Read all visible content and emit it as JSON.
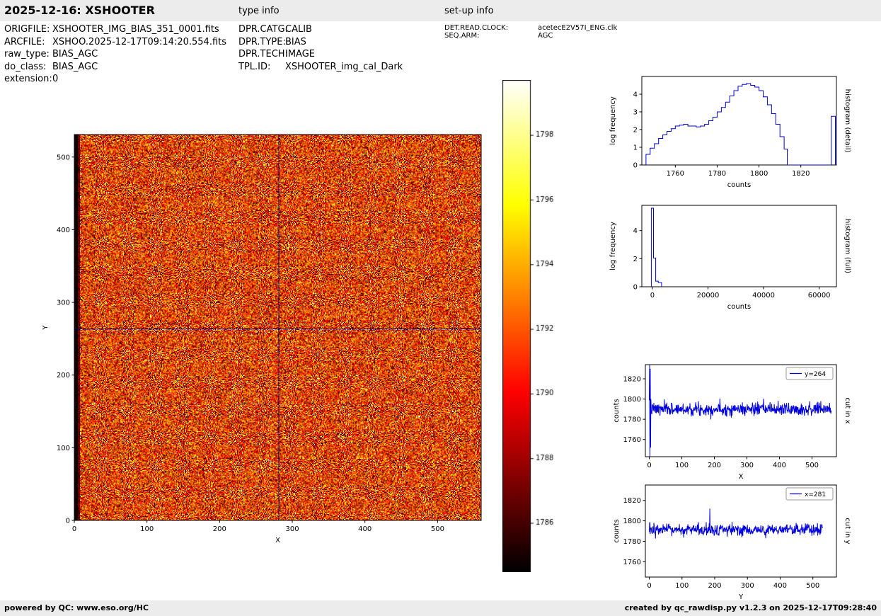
{
  "header": {
    "title": "2025-12-16: XSHOOTER",
    "type_info_label": "type info",
    "setup_info_label": "set-up info"
  },
  "meta": {
    "left": [
      {
        "label": "ORIGFILE:",
        "value": "XSHOOTER_IMG_BIAS_351_0001.fits"
      },
      {
        "label": "ARCFILE:",
        "value": "XSHOO.2025-12-17T09:14:20.554.fits"
      },
      {
        "label": "raw_type:",
        "value": "BIAS_AGC"
      },
      {
        "label": "do_class:",
        "value": "BIAS_AGC"
      },
      {
        "label": "extension:",
        "value": "0"
      }
    ],
    "type": [
      {
        "label": "DPR.CATG:",
        "value": "CALIB"
      },
      {
        "label": "DPR.TYPE:",
        "value": "BIAS"
      },
      {
        "label": "DPR.TECH:",
        "value": "IMAGE"
      },
      {
        "label": "TPL.ID:",
        "value": "XSHOOTER_img_cal_Dark"
      }
    ],
    "setup": [
      {
        "label": "DET.READ.CLOCK:",
        "value": "acetecE2V57I_ENG.clk"
      },
      {
        "label": "SEQ.ARM:",
        "value": "AGC"
      }
    ]
  },
  "footer": {
    "left": "powered by QC: www.eso.org/HC",
    "right": "created by qc_rawdisp.py v1.2.3 on 2025-12-17T09:28:40"
  },
  "chart_data": [
    {
      "id": "bias_image",
      "type": "heatmap",
      "xlabel": "X",
      "ylabel": "Y",
      "xlim": [
        0,
        560
      ],
      "ylim": [
        0,
        531
      ],
      "xticks": [
        0,
        100,
        200,
        300,
        400,
        500
      ],
      "yticks": [
        0,
        100,
        200,
        300,
        400,
        500
      ],
      "colormap": "hot",
      "counts_range": [
        1784.5,
        1799.7
      ],
      "mean_counts": 1791,
      "noise_sigma_counts": 3.4,
      "dark_left_columns": 8,
      "crosshair": {
        "x": 281,
        "y": 264,
        "color": "#00008b"
      },
      "seed": 42
    },
    {
      "id": "colorbar",
      "type": "colorbar",
      "colormap": "hot",
      "range": [
        1784.5,
        1799.7
      ],
      "ticks": [
        1786,
        1788,
        1790,
        1792,
        1794,
        1796,
        1798
      ]
    },
    {
      "id": "histogram_detail",
      "type": "steps",
      "right_label": "histogram (detail)",
      "xlabel": "counts",
      "ylabel": "log frequency",
      "xlim": [
        1744,
        1837
      ],
      "ylim": [
        0,
        5
      ],
      "xticks": [
        1760,
        1780,
        1800,
        1820
      ],
      "yticks": [
        0,
        1,
        2,
        3,
        4
      ],
      "line_color": "#0000dd",
      "x": [
        1746,
        1748,
        1750,
        1752,
        1754,
        1756,
        1758,
        1760,
        1762,
        1764,
        1766,
        1768,
        1770,
        1772,
        1774,
        1776,
        1778,
        1780,
        1782,
        1784,
        1786,
        1788,
        1790,
        1792,
        1794,
        1796,
        1798,
        1800,
        1802,
        1804,
        1806,
        1808,
        1810,
        1812,
        1813.5,
        1834.5,
        1836.5
      ],
      "y": [
        0.6,
        0.95,
        1.2,
        1.5,
        1.7,
        1.9,
        2.05,
        2.2,
        2.25,
        2.3,
        2.2,
        2.2,
        2.15,
        2.2,
        2.3,
        2.5,
        2.7,
        3.0,
        3.25,
        3.55,
        3.9,
        4.2,
        4.45,
        4.55,
        4.6,
        4.5,
        4.4,
        4.2,
        3.85,
        3.4,
        2.9,
        2.3,
        1.6,
        0.9,
        0,
        2.75,
        0
      ]
    },
    {
      "id": "histogram_full",
      "type": "steps",
      "right_label": "histogram (full)",
      "xlabel": "counts",
      "ylabel": "log frequency",
      "xlim": [
        -3800,
        66200
      ],
      "ylim": [
        0,
        5.8
      ],
      "xticks": [
        0,
        20000,
        40000,
        60000
      ],
      "yticks": [
        0,
        2,
        4
      ],
      "line_color": "#0000dd",
      "x": [
        -400,
        400,
        1200,
        2100,
        3300
      ],
      "y": [
        5.6,
        2.05,
        0.4,
        0.3,
        0
      ]
    },
    {
      "id": "cut_x",
      "type": "noise_line",
      "legend": "y=264",
      "right_label": "cut in x",
      "xlabel": "X",
      "ylabel": "counts",
      "xlim": [
        -12,
        575
      ],
      "ylim": [
        1743,
        1834
      ],
      "xticks": [
        0,
        100,
        200,
        300,
        400,
        500
      ],
      "yticks": [
        1760,
        1780,
        1800,
        1820
      ],
      "line_color": "#0000dd",
      "n": 560,
      "baseline": 1790,
      "sigma": 3.2,
      "seed": 7,
      "spikes": [
        [
          1,
          1834
        ],
        [
          2,
          1743
        ],
        [
          3,
          1830
        ],
        [
          4,
          1752
        ],
        [
          5,
          1800
        ]
      ]
    },
    {
      "id": "cut_y",
      "type": "noise_line",
      "legend": "x=281",
      "right_label": "cut in y",
      "xlabel": "Y",
      "ylabel": "counts",
      "xlim": [
        -12,
        572
      ],
      "ylim": [
        1745,
        1835
      ],
      "xticks": [
        0,
        100,
        200,
        300,
        400,
        500
      ],
      "yticks": [
        1760,
        1780,
        1800,
        1820
      ],
      "line_color": "#0000dd",
      "n": 531,
      "baseline": 1791,
      "sigma": 3.0,
      "seed": 13,
      "spikes": [
        [
          185,
          1812
        ]
      ]
    }
  ]
}
